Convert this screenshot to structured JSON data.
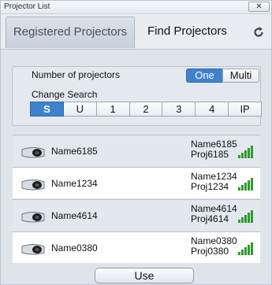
{
  "window": {
    "title": "Projector List",
    "close_label": "✕"
  },
  "tabs": [
    {
      "label": "Registered Projectors",
      "active": true
    },
    {
      "label": "Find Projectors",
      "active": false
    }
  ],
  "toolbar": {
    "refresh_icon": "refresh-icon"
  },
  "options": {
    "number_label": "Number of projectors",
    "mode": {
      "one": "One",
      "multi": "Multi",
      "selected": "One"
    },
    "change_search_label": "Change Search",
    "search_keys": [
      "S",
      "U",
      "1",
      "2",
      "3",
      "4",
      "IP"
    ],
    "selected_key": "S"
  },
  "projectors": [
    {
      "name": "Name6185",
      "detail_name": "Name6185",
      "detail_proj": "Proj6185",
      "icon": "projector-icon",
      "signal": "signal-strength-icon"
    },
    {
      "name": "Name1234",
      "detail_name": "Name1234",
      "detail_proj": "Proj1234",
      "icon": "projector-icon",
      "signal": "signal-strength-icon"
    },
    {
      "name": "Name4614",
      "detail_name": "Name4614",
      "detail_proj": "Proj4614",
      "icon": "projector-icon",
      "signal": "signal-strength-icon"
    },
    {
      "name": "Name0380",
      "detail_name": "Name0380",
      "detail_proj": "Proj0380",
      "icon": "projector-icon",
      "signal": "signal-strength-icon"
    }
  ],
  "actions": {
    "use_label": "Use"
  },
  "colors": {
    "accent": "#3f82cc",
    "signal": "#2f9a2f",
    "panel": "#dfe4eb"
  }
}
